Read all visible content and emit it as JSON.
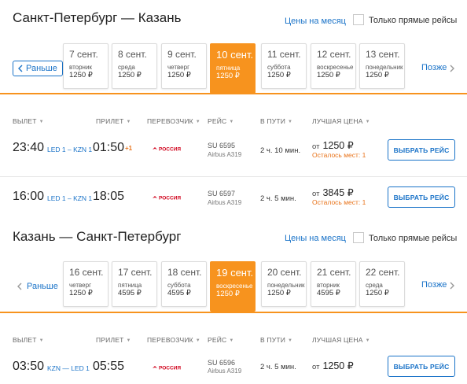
{
  "outbound": {
    "title": "Санкт-Петербург — Казань",
    "month_prices_link": "Цены на месяц",
    "direct_only_label": "Только прямые рейсы",
    "earlier_label": "Раньше",
    "later_label": "Позже",
    "dates": [
      {
        "date": "7 сент.",
        "weekday": "вторник",
        "price": "1250 ₽",
        "active": false
      },
      {
        "date": "8 сент.",
        "weekday": "среда",
        "price": "1250 ₽",
        "active": false
      },
      {
        "date": "9 сент.",
        "weekday": "четверг",
        "price": "1250 ₽",
        "active": false
      },
      {
        "date": "10 сент.",
        "weekday": "пятница",
        "price": "1250 ₽",
        "active": true
      },
      {
        "date": "11 сент.",
        "weekday": "суббота",
        "price": "1250 ₽",
        "active": false
      },
      {
        "date": "12 сент.",
        "weekday": "воскресенье",
        "price": "1250 ₽",
        "active": false
      },
      {
        "date": "13 сент.",
        "weekday": "понедельник",
        "price": "1250 ₽",
        "active": false
      }
    ],
    "columns": {
      "departure": "ВЫЛЕТ",
      "arrival": "ПРИЛЕТ",
      "carrier": "ПЕРЕВОЗЧИК",
      "flight": "РЕЙС",
      "duration": "В ПУТИ",
      "best_price": "ЛУЧШАЯ ЦЕНА"
    },
    "flights": [
      {
        "departure": "23:40",
        "route": "LED 1 – KZN 1",
        "arrival": "01:50",
        "next_day": "+1",
        "carrier_name": "РОССИЯ",
        "flight_no": "SU 6595",
        "aircraft": "Airbus A319",
        "duration": "2 ч. 10 мин.",
        "price_prefix": "от",
        "price": "1250 ₽",
        "seats_left": "Осталось мест: 1",
        "button": "ВЫБРАТЬ РЕЙС"
      },
      {
        "departure": "16:00",
        "route": "LED 1 – KZN 1",
        "arrival": "18:05",
        "next_day": "",
        "carrier_name": "РОССИЯ",
        "flight_no": "SU 6597",
        "aircraft": "Airbus A319",
        "duration": "2 ч. 5 мин.",
        "price_prefix": "от",
        "price": "3845 ₽",
        "seats_left": "Осталось мест: 1",
        "button": "ВЫБРАТЬ РЕЙС"
      }
    ]
  },
  "return": {
    "title": "Казань — Санкт-Петербург",
    "month_prices_link": "Цены на месяц",
    "direct_only_label": "Только прямые рейсы",
    "earlier_label": "Раньше",
    "later_label": "Позже",
    "dates": [
      {
        "date": "16 сент.",
        "weekday": "четверг",
        "price": "1250 ₽",
        "active": false
      },
      {
        "date": "17 сент.",
        "weekday": "пятница",
        "price": "4595 ₽",
        "active": false
      },
      {
        "date": "18 сент.",
        "weekday": "суббота",
        "price": "4595 ₽",
        "active": false
      },
      {
        "date": "19 сент.",
        "weekday": "воскресенье",
        "price": "1250 ₽",
        "active": true
      },
      {
        "date": "20 сент.",
        "weekday": "понедельник",
        "price": "1250 ₽",
        "active": false
      },
      {
        "date": "21 сент.",
        "weekday": "вторник",
        "price": "4595 ₽",
        "active": false
      },
      {
        "date": "22 сент.",
        "weekday": "среда",
        "price": "1250 ₽",
        "active": false
      }
    ],
    "columns": {
      "departure": "ВЫЛЕТ",
      "arrival": "ПРИЛЕТ",
      "carrier": "ПЕРЕВОЗЧИК",
      "flight": "РЕЙС",
      "duration": "В ПУТИ",
      "best_price": "ЛУЧШАЯ ЦЕНА"
    },
    "flights": [
      {
        "departure": "03:50",
        "route": "KZN — LED 1",
        "arrival": "05:55",
        "carrier_name": "РОССИЯ",
        "flight_no": "SU 6596",
        "aircraft": "Airbus A319",
        "duration": "2 ч. 5 мин.",
        "price_prefix": "от",
        "price": "1250 ₽",
        "button": "ВЫБРАТЬ РЕЙС"
      }
    ]
  },
  "colors": {
    "accent_orange": "#f7931e",
    "link_blue": "#1a73c8",
    "airline_red": "#d0021b"
  },
  "icons": {
    "earlier": "chevron-left-icon",
    "later": "chevron-right-icon",
    "sort": "caret-down-icon",
    "airline": "rossiya-logo-icon"
  }
}
